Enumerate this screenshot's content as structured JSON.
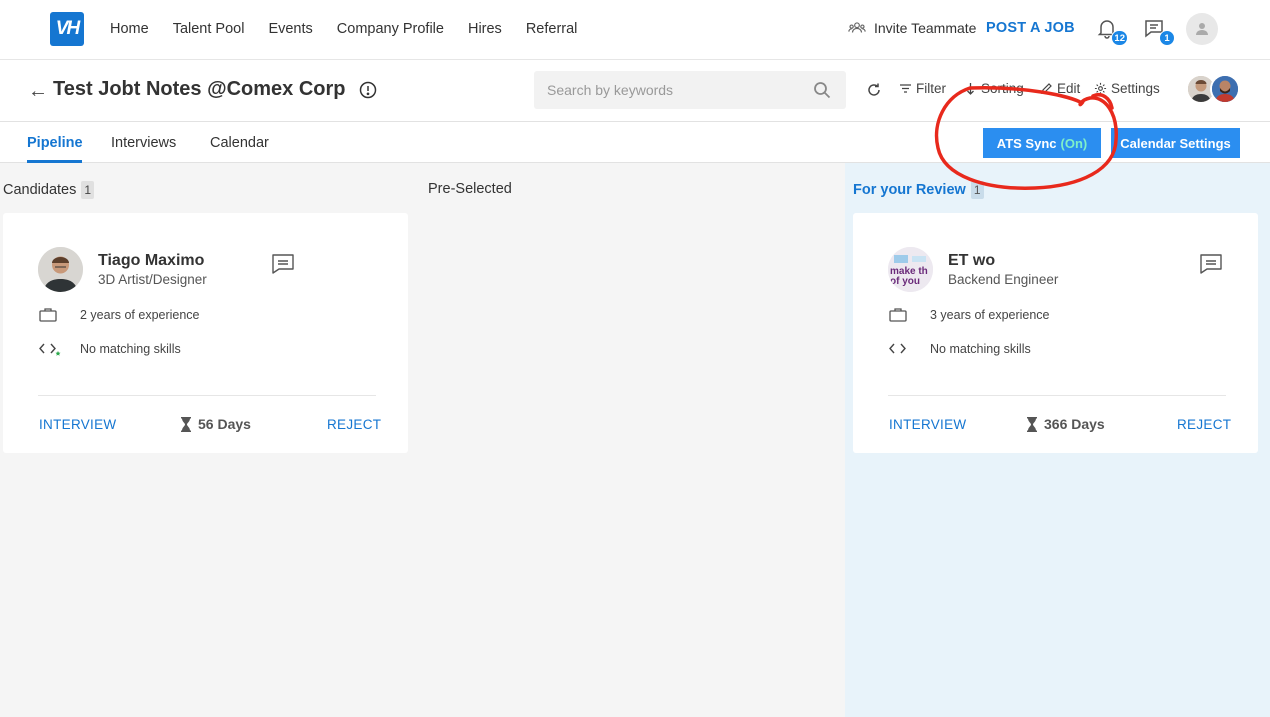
{
  "nav": {
    "logo_text": "VH",
    "links": [
      "Home",
      "Talent Pool",
      "Events",
      "Company Profile",
      "Hires",
      "Referral"
    ],
    "invite_label": "Invite Teammate",
    "post_job_label": "POST A JOB",
    "notifications_count": "12",
    "messages_count": "1"
  },
  "job": {
    "title": "Test Jobt Notes @Comex Corp",
    "search_placeholder": "Search by keywords",
    "filter_label": "Filter",
    "sorting_label": "Sorting",
    "edit_label": "Edit",
    "settings_label": "Settings"
  },
  "tabs": {
    "pipeline": "Pipeline",
    "interviews": "Interviews",
    "calendar": "Calendar",
    "ats_sync_label": "ATS Sync",
    "ats_sync_status": "(On)",
    "calendar_settings_label": "Calendar Settings"
  },
  "columns": {
    "candidates": {
      "title": "Candidates",
      "count": "1"
    },
    "preselected": {
      "title": "Pre-Selected"
    },
    "review": {
      "title": "For your Review",
      "count": "1"
    }
  },
  "cards": [
    {
      "name": "Tiago Maximo",
      "role": "3D Artist/Designer",
      "experience": "2 years of experience",
      "skills": "No matching skills",
      "interview_label": "INTERVIEW",
      "days": "56 Days",
      "reject_label": "REJECT"
    },
    {
      "name": "ET wo",
      "role": "Backend Engineer",
      "experience": "3 years of experience",
      "skills": "No matching skills",
      "interview_label": "INTERVIEW",
      "days": "366 Days",
      "reject_label": "REJECT",
      "avatar_text": "make th of you"
    }
  ],
  "colors": {
    "brand": "#1576d1",
    "button": "#2b8ef0",
    "review_bg": "#e8f3fa",
    "annotation": "#e8291c"
  }
}
